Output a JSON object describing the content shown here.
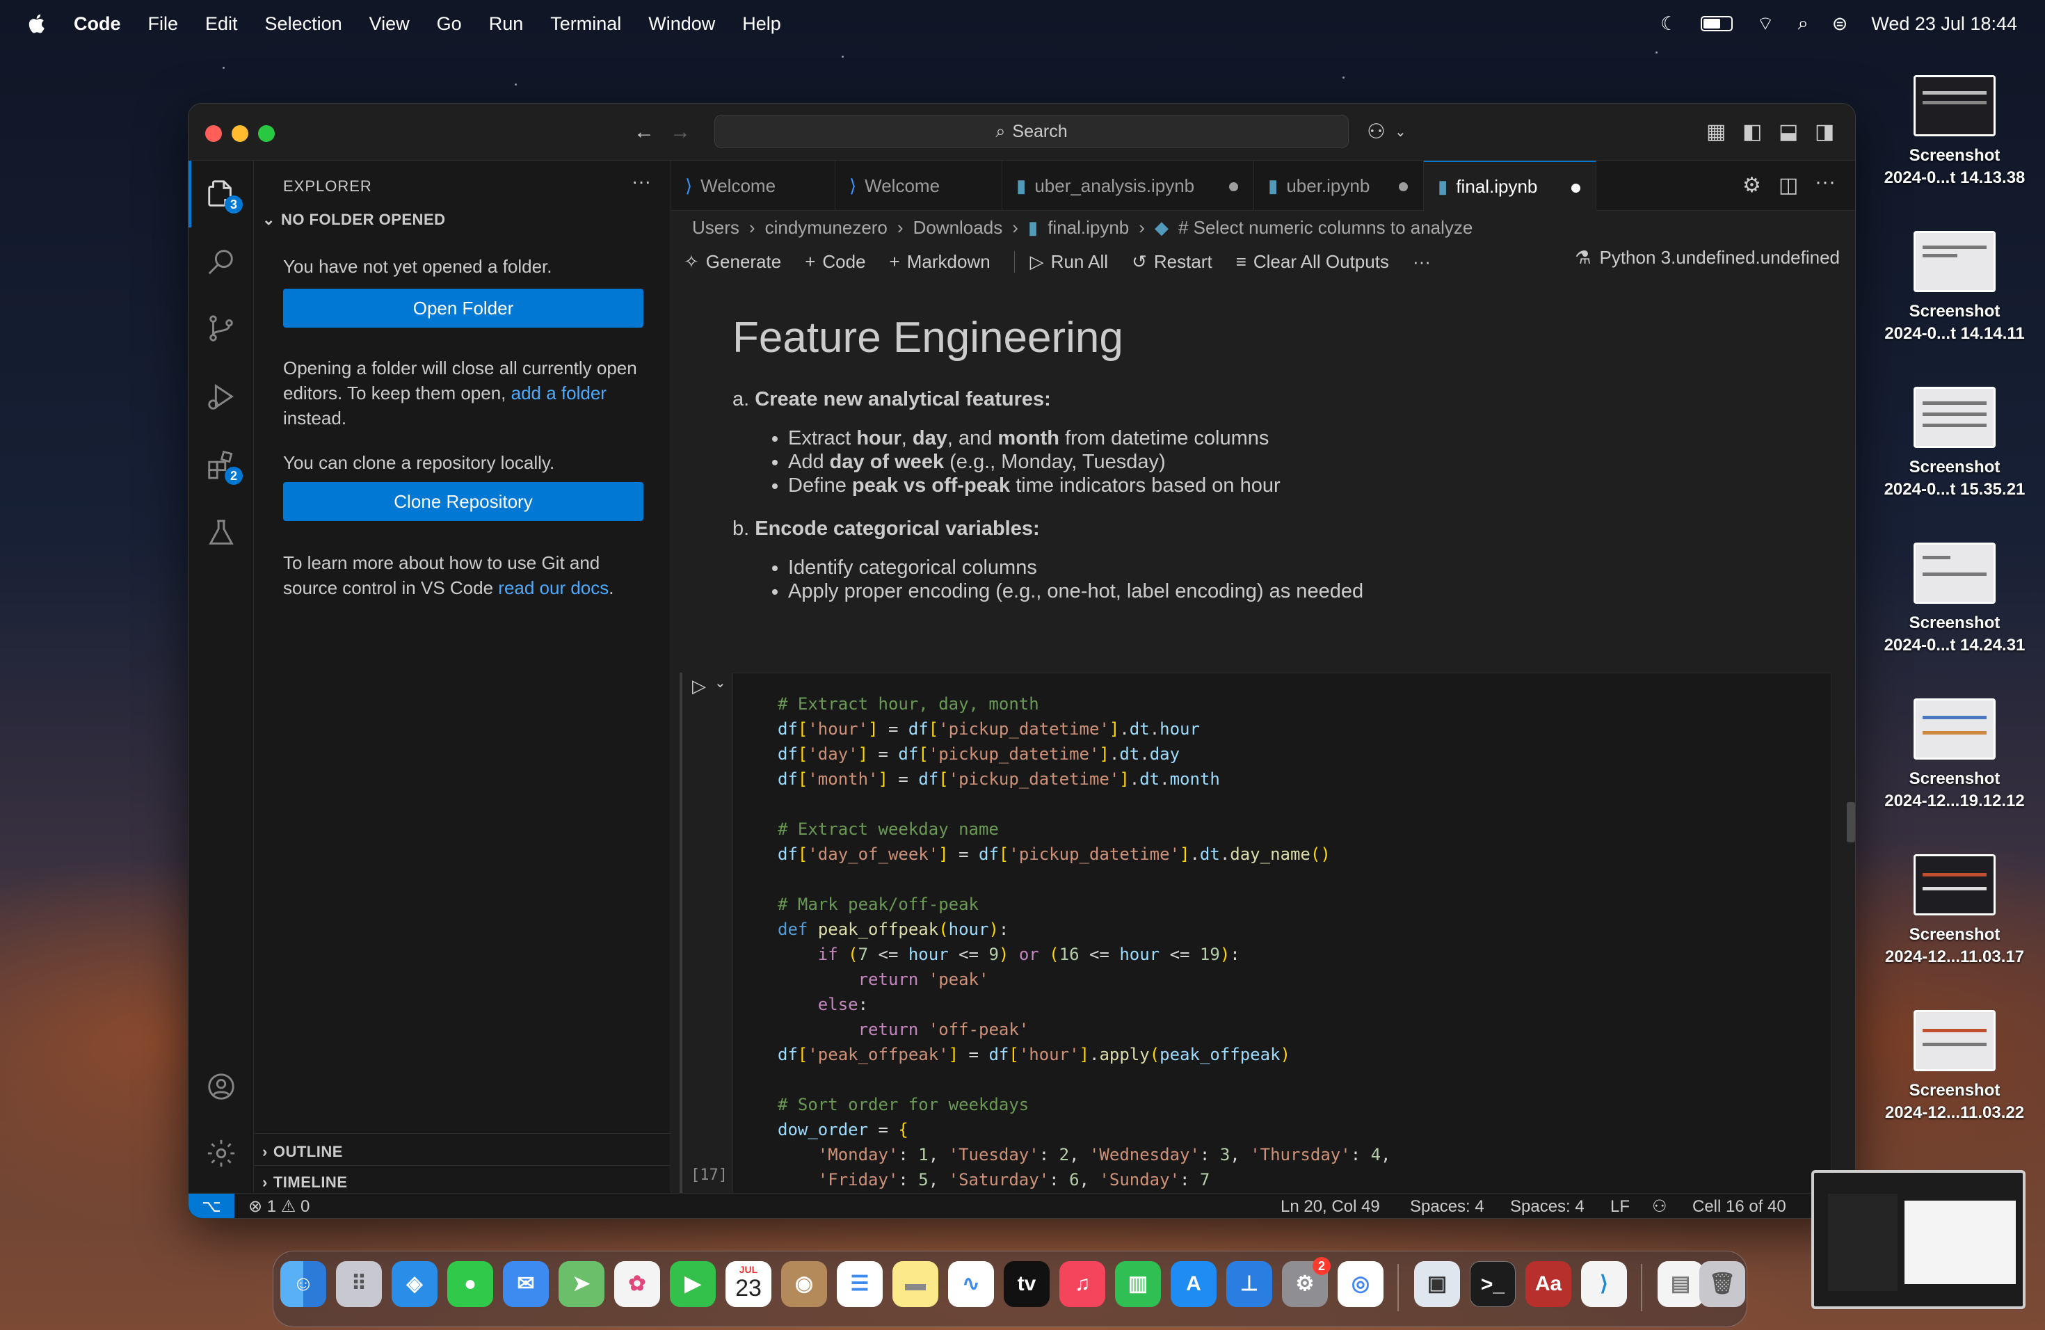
{
  "menubar": {
    "app": "Code",
    "items": [
      "File",
      "Edit",
      "Selection",
      "View",
      "Go",
      "Run",
      "Terminal",
      "Window",
      "Help"
    ],
    "datetime": "Wed 23 Jul  18:44"
  },
  "desktop_icons": [
    {
      "name": "Screenshot",
      "sub": "2024-0...t 14.13.38"
    },
    {
      "name": "Screenshot",
      "sub": "2024-0...t 14.14.11"
    },
    {
      "name": "Screenshot",
      "sub": "2024-0...t 15.35.21"
    },
    {
      "name": "Screenshot",
      "sub": "2024-0...t 14.24.31"
    },
    {
      "name": "Screenshot",
      "sub": "2024-12...19.12.12"
    },
    {
      "name": "Screenshot",
      "sub": "2024-12...11.03.17"
    },
    {
      "name": "Screenshot",
      "sub": "2024-12...11.03.22"
    }
  ],
  "titlebar": {
    "search": "Search"
  },
  "activity": {
    "explorer_badge": "3",
    "extensions_badge": "2"
  },
  "sidebar": {
    "title": "EXPLORER",
    "section": "NO FOLDER OPENED",
    "msg1": "You have not yet opened a folder.",
    "open_folder": "Open Folder",
    "msg2_a": "Opening a folder will close all currently open editors. To keep them open, ",
    "msg2_link": "add a folder",
    "msg2_b": " instead.",
    "msg3": "You can clone a repository locally.",
    "clone": "Clone Repository",
    "msg4_a": "To learn more about how to use Git and source control in VS Code ",
    "msg4_link": "read our docs",
    "msg4_b": ".",
    "outline": "OUTLINE",
    "timeline": "TIMELINE"
  },
  "tabs": [
    {
      "label": "Welcome"
    },
    {
      "label": "Welcome"
    },
    {
      "label": "uber_analysis.ipynb"
    },
    {
      "label": "uber.ipynb"
    },
    {
      "label": "final.ipynb"
    }
  ],
  "breadcrumb": [
    "Users",
    "cindymunezero",
    "Downloads",
    "final.ipynb",
    "# Select numeric columns to analyze"
  ],
  "toolbar": {
    "generate": "Generate",
    "code": "Code",
    "markdown": "Markdown",
    "run_all": "Run All",
    "restart": "Restart",
    "clear": "Clear All Outputs",
    "kernel": "Python 3.undefined.undefined"
  },
  "markdown": {
    "heading": "Feature Engineering",
    "a_prefix": "a. ",
    "a_title": "Create new analytical features:",
    "a_items": [
      [
        "Extract ",
        "hour",
        ", ",
        "day",
        ", and ",
        "month",
        " from datetime columns"
      ],
      [
        "Add ",
        "day of week",
        " (e.g., Monday, Tuesday)"
      ],
      [
        "Define ",
        "peak vs off-peak",
        " time indicators based on hour"
      ]
    ],
    "b_prefix": "b. ",
    "b_title": "Encode categorical variables:",
    "b_items": [
      "Identify categorical columns",
      "Apply proper encoding (e.g., one-hot, label encoding) as needed"
    ]
  },
  "cell": {
    "exec_count": "[17]",
    "code": [
      "# Extract hour, day, month",
      "df['hour'] = df['pickup_datetime'].dt.hour",
      "df['day'] = df['pickup_datetime'].dt.day",
      "df['month'] = df['pickup_datetime'].dt.month",
      "",
      "# Extract weekday name",
      "df['day_of_week'] = df['pickup_datetime'].dt.day_name()",
      "",
      "# Mark peak/off-peak",
      "def peak_offpeak(hour):",
      "    if (7 <= hour <= 9) or (16 <= hour <= 19):",
      "        return 'peak'",
      "    else:",
      "        return 'off-peak'",
      "df['peak_offpeak'] = df['hour'].apply(peak_offpeak)",
      "",
      "# Sort order for weekdays",
      "dow_order = {",
      "    'Monday': 1, 'Tuesday': 2, 'Wednesday': 3, 'Thursday': 4,",
      "    'Friday': 5, 'Saturday': 6, 'Sunday': 7"
    ]
  },
  "status": {
    "errors": "1",
    "warnings": "0",
    "position": "Ln 20, Col 49",
    "spaces1": "Spaces: 4",
    "spaces2": "Spaces: 4",
    "eol": "LF",
    "cell": "Cell 16 of 40"
  },
  "dock": {
    "calendar_month": "JUL",
    "calendar_day": "23",
    "settings_badge": "2",
    "apps": [
      "finder-icon",
      "launchpad-icon",
      "safari-icon",
      "messages-icon",
      "mail-icon",
      "maps-icon",
      "photos-icon",
      "facetime-icon",
      "calendar-icon",
      "contacts-icon",
      "reminders-icon",
      "notes-icon",
      "freeform-icon",
      "tv-icon",
      "music-icon",
      "numbers-icon",
      "app-store-icon",
      "keynote-icon",
      "system-settings-icon",
      "chrome-icon",
      "preview-icon",
      "terminal-icon",
      "dictionary-icon",
      "vscode-icon",
      "document-icon",
      "trash-icon"
    ]
  },
  "colors": {
    "accent": "#0078d4",
    "link": "#4daafc",
    "editor_bg": "#1f1f1f",
    "sidebar_bg": "#181818"
  }
}
